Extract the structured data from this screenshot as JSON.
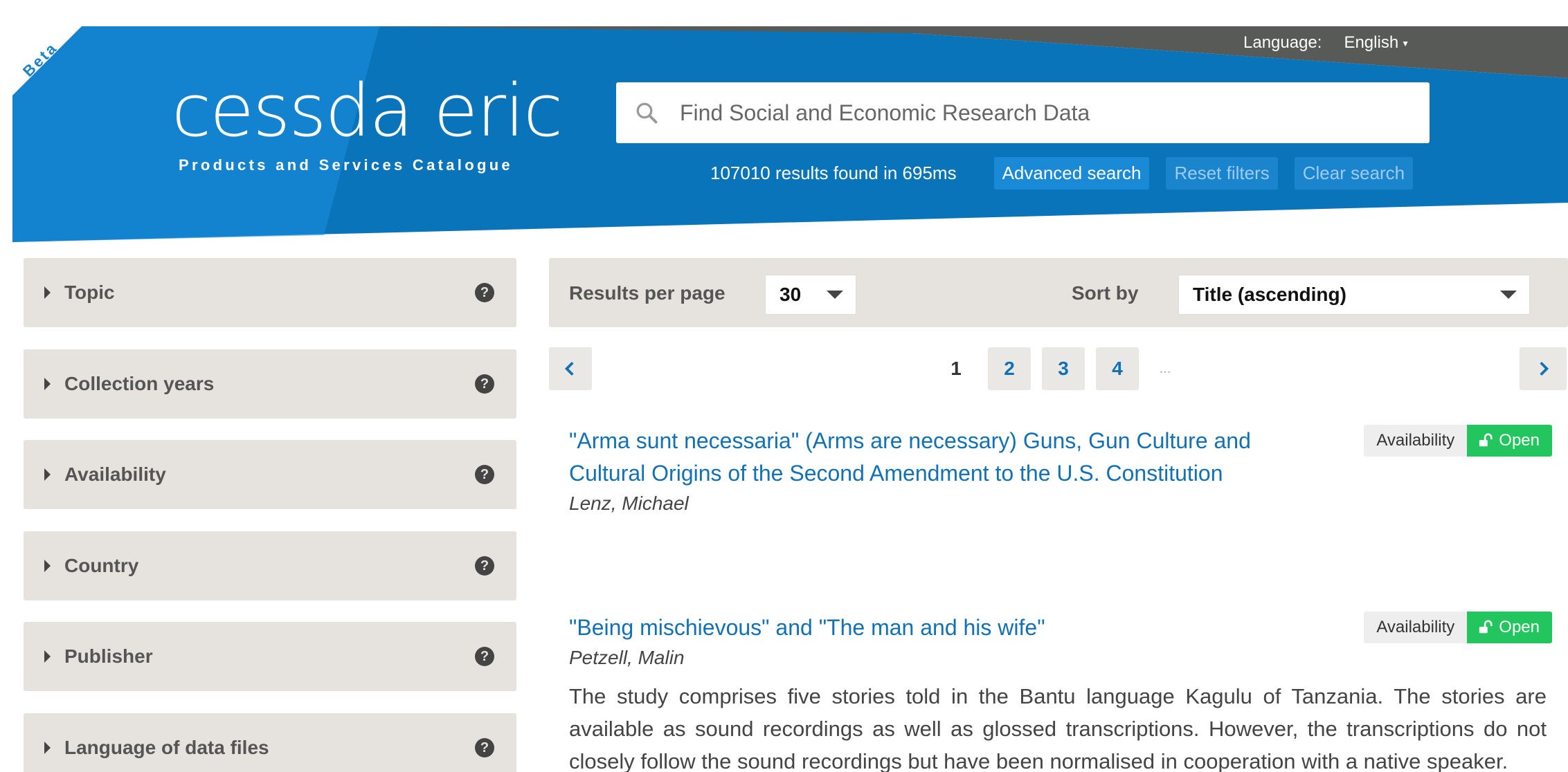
{
  "header": {
    "beta": "Beta",
    "logo_main": "cessda eric",
    "logo_sub": "Products and Services Catalogue",
    "language_label": "Language:",
    "language_value": "English",
    "search_placeholder": "Find Social and Economic Research Data",
    "results_count": "107010 results found in 695ms",
    "advanced_search": "Advanced search",
    "reset_filters": "Reset filters",
    "clear_search": "Clear search"
  },
  "sidebar": {
    "facets": [
      {
        "label": "Topic"
      },
      {
        "label": "Collection years"
      },
      {
        "label": "Availability"
      },
      {
        "label": "Country"
      },
      {
        "label": "Publisher"
      },
      {
        "label": "Language of data files"
      }
    ]
  },
  "results_bar": {
    "per_page_label": "Results per page",
    "per_page_value": "30",
    "sort_label": "Sort by",
    "sort_value": "Title (ascending)"
  },
  "pagination": {
    "pages": [
      "1",
      "2",
      "3",
      "4"
    ],
    "current": "1",
    "ellipsis": "..."
  },
  "results": [
    {
      "title": "\"Arma sunt necessaria\" (Arms are necessary) Guns, Gun Culture and Cultural Origins of the Second Amendment to the U.S. Constitution",
      "author": "Lenz, Michael",
      "availability_label": "Availability",
      "availability_value": "Open",
      "description": ""
    },
    {
      "title": "\"Being mischievous\" and \"The man and his wife\"",
      "author": "Petzell, Malin",
      "availability_label": "Availability",
      "availability_value": "Open",
      "description": "The study comprises five stories told in the Bantu language Kagulu of Tanzania. The stories are available as sound recordings as well as glossed transcriptions. However, the transcriptions do not closely follow the sound recordings but have been normalised in cooperation with a native speaker."
    }
  ],
  "colors": {
    "header_blue": "#0a74bb",
    "header_light_blue": "#1b8fe0",
    "topbar_gray": "#575a56",
    "link_blue": "#1271b5",
    "open_green": "#22c55e",
    "panel_gray": "#e6e3df"
  },
  "icons": {
    "search": "search-icon",
    "help": "question-circle-icon",
    "facet_toggle": "caret-right-icon",
    "prev": "chevron-left-icon",
    "next": "chevron-right-icon",
    "open": "unlock-icon"
  }
}
